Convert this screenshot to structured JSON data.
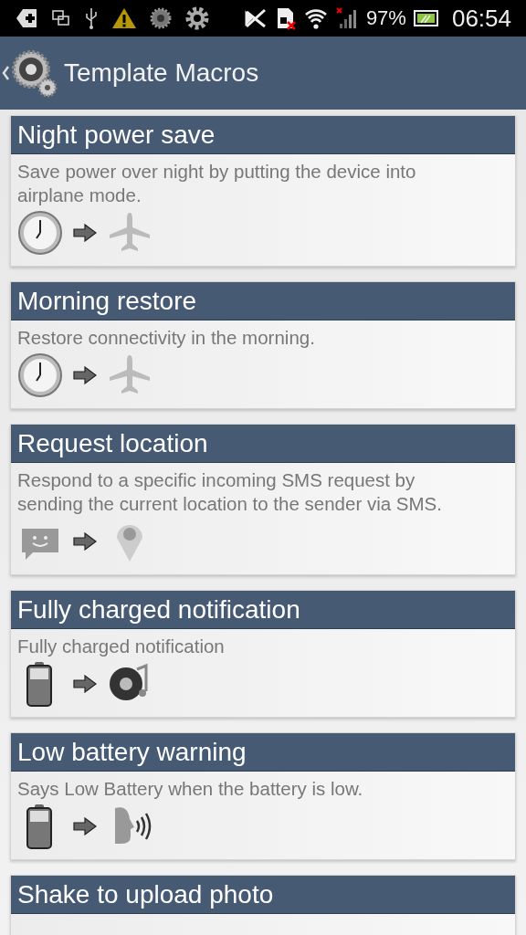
{
  "status_bar": {
    "battery": "97%",
    "time": "06:54"
  },
  "app_bar": {
    "title": "Template Macros"
  },
  "macros": [
    {
      "title": "Night power save",
      "description": "Save power over night by putting the device into airplane mode.",
      "trigger": {
        "kind": "clock"
      },
      "action": {
        "kind": "airplane"
      }
    },
    {
      "title": "Morning restore",
      "description": "Restore connectivity in the morning.",
      "trigger": {
        "kind": "clock"
      },
      "action": {
        "kind": "airplane"
      }
    },
    {
      "title": "Request location",
      "description": "Respond to a specific incoming SMS request by sending the current location to the sender via SMS.",
      "trigger": {
        "kind": "message"
      },
      "action": {
        "kind": "location"
      }
    },
    {
      "title": "Fully charged notification",
      "description": "Fully charged notification",
      "trigger": {
        "kind": "battery"
      },
      "action": {
        "kind": "sound"
      }
    },
    {
      "title": "Low battery warning",
      "description": "Says Low Battery when the battery is low.",
      "trigger": {
        "kind": "battery"
      },
      "action": {
        "kind": "speak"
      }
    },
    {
      "title": "Shake to upload photo"
    }
  ]
}
